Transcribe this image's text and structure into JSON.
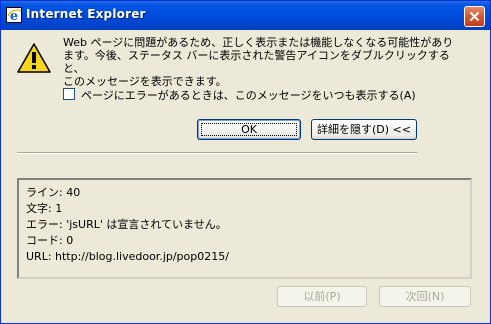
{
  "window": {
    "title": "Internet Explorer"
  },
  "message": {
    "line1": "Web ページに問題があるため、正しく表示または機能しなくなる可能性があり",
    "line2": "ます。今後、ステータス バーに表示された警告アイコンをダブルクリックすると、",
    "line3": "このメッセージを表示できます。"
  },
  "checkbox": {
    "label": "ページにエラーがあるときは、このメッセージをいつも表示する(A)",
    "checked": false
  },
  "buttons": {
    "ok": "OK",
    "hide_details": "詳細を隠す(D) <<",
    "prev": "以前(P)",
    "next": "次回(N)"
  },
  "details": {
    "line": "ライン: 40",
    "char": "文字: 1",
    "error": "エラー: 'jsURL' は宣言されていません。",
    "code": "コード: 0",
    "url": "URL:  http://blog.livedoor.jp/pop0215/"
  },
  "colors": {
    "titlebar": "#0054e3",
    "dialog_bg": "#ece9d8",
    "close_button": "#d25a36"
  },
  "icons": {
    "title": "ie-logo-icon",
    "warning": "warning-icon",
    "close": "close-icon"
  }
}
